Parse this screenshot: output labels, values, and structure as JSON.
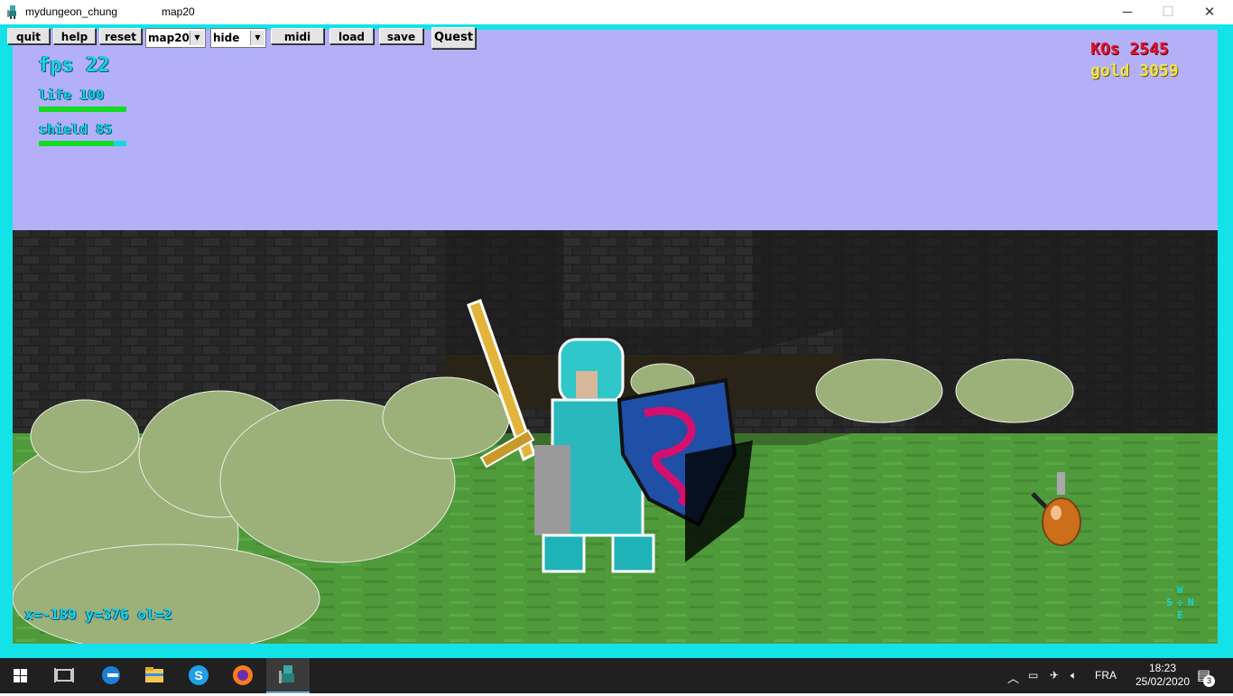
{
  "window": {
    "app_name": "mydungeon_chung",
    "map_name": "map20",
    "minimize_glyph": "─",
    "maximize_glyph": "☐",
    "close_glyph": "✕"
  },
  "toolbar": {
    "quit": "quit",
    "help": "help",
    "reset": "reset",
    "map_select": "map20",
    "hide_select": "hide",
    "midi": "midi",
    "load": "load",
    "save": "save",
    "quest": "Quest"
  },
  "hud": {
    "fps": "fps 22",
    "life": "life 100",
    "life_level": 1.0,
    "shield": "shield 85",
    "shield_level": 0.85,
    "kos": "KOs 2545",
    "gold": "gold 3059",
    "coords": "x=-189 y=376 ol=2",
    "compass": {
      "top": "W",
      "left": "S",
      "right": "N",
      "bottom": "E"
    }
  },
  "colors": {
    "frame": "#13e3e8",
    "sky": "#b3b0f8",
    "wall": "#1e1e1e",
    "grass": "#4f9a3a",
    "kos": "#e0152c",
    "gold": "#f0e34a",
    "hud_cyan": "#14d6e0",
    "bar_green": "#14dc22"
  },
  "taskbar": {
    "language": "FRA",
    "time": "18:23",
    "date": "25/02/2020",
    "notifications": "3",
    "apps": [
      "windows-start-icon",
      "task-view-icon",
      "edge-icon",
      "file-explorer-icon",
      "skype-icon",
      "firefox-icon",
      "mydungeon-app-icon"
    ]
  }
}
